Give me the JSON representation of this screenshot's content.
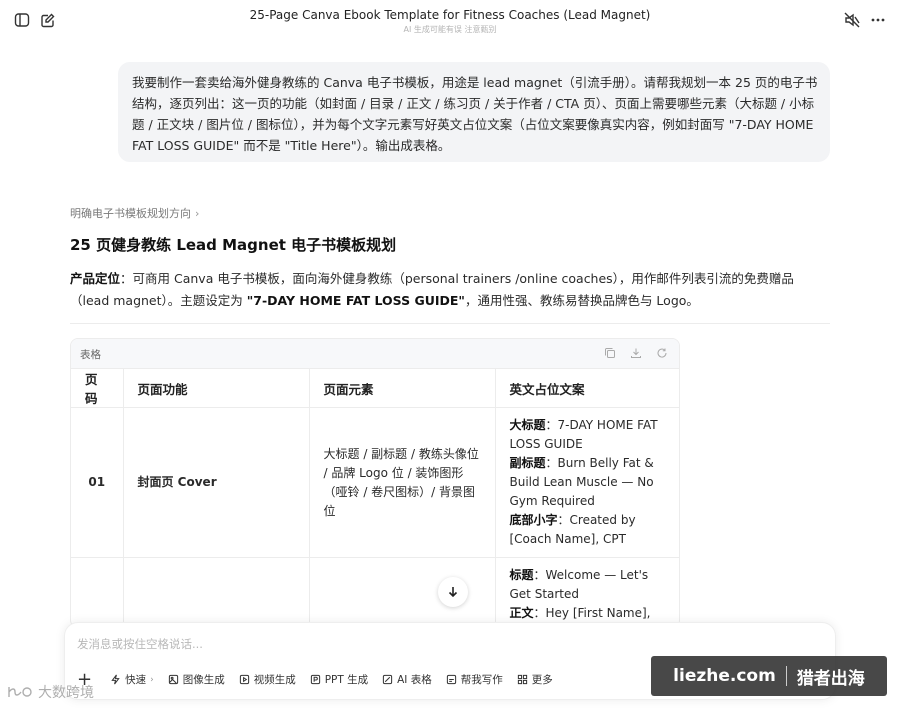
{
  "header": {
    "title": "25-Page Canva Ebook Template for Fitness Coaches (Lead Magnet)",
    "subtitle": "AI 生成可能有误 注意甄别"
  },
  "user_message": "我要制作一套卖给海外健身教练的 Canva 电子书模板，用途是 lead magnet（引流手册）。请帮我规划一本 25 页的电子书结构，逐页列出：这一页的功能（如封面 / 目录 / 正文 / 练习页 / 关于作者 / CTA 页）、页面上需要哪些元素（大标题 / 小标题 / 正文块 / 图片位 / 图标位），并为每个文字元素写好英文占位文案（占位文案要像真实内容，例如封面写 \"7-DAY HOME FAT LOSS GUIDE\" 而不是 \"Title Here\"）。输出成表格。",
  "answer": {
    "breadcrumb": "明确电子书模板规划方向",
    "title": "25 页健身教练 Lead Magnet 电子书模板规划",
    "positioning_label": "产品定位",
    "positioning_text_1": "：可商用 Canva 电子书模板，面向海外健身教练（personal trainers /online coaches），用作邮件列表引流的免费赠品（lead magnet）。主题设定为 ",
    "positioning_bold": "\"7-DAY HOME FAT LOSS GUIDE\"",
    "positioning_text_2": "，通用性强、教练易替换品牌色与 Logo。"
  },
  "table": {
    "label": "表格",
    "headers": [
      "页码",
      "页面功能",
      "页面元素",
      "英文占位文案"
    ],
    "rows": [
      {
        "page": "01",
        "function": "封面页 Cover",
        "elements": "大标题 / 副标题 / 教练头像位 / 品牌 Logo 位 / 装饰图形（哑铃 / 卷尺图标）/ 背景图位",
        "copy": [
          {
            "label": "大标题",
            "text": "：7-DAY HOME FAT LOSS GUIDE"
          },
          {
            "label": "副标题",
            "text": "：Burn Belly Fat & Build Lean Muscle — No Gym Required"
          },
          {
            "label": "底部小字",
            "text": "：Created by [Coach Name], CPT"
          }
        ]
      },
      {
        "page": "",
        "function": "",
        "elements": "",
        "copy": [
          {
            "label": "标题",
            "text": "：Welcome — Let's Get Started"
          },
          {
            "label": "正文",
            "text": "：Hey [First Name],"
          }
        ]
      }
    ]
  },
  "composer": {
    "placeholder": "发消息或按住空格说话...",
    "tools": [
      "快速",
      "图像生成",
      "视频生成",
      "PPT 生成",
      "AI 表格",
      "帮我写作",
      "更多"
    ]
  },
  "watermarks": {
    "left": "大数跨境",
    "right_domain": "liezhe.com",
    "right_brand": "猎者出海"
  }
}
